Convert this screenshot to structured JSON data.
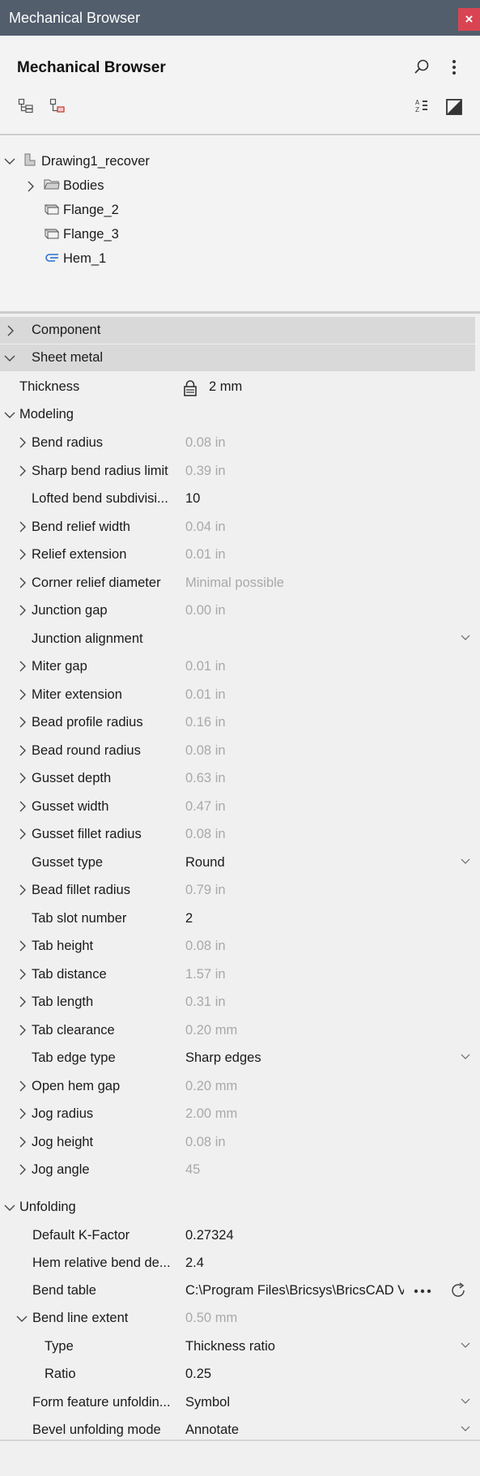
{
  "window": {
    "title": "Mechanical Browser",
    "close_glyph": "×"
  },
  "panel": {
    "title": "Mechanical Browser"
  },
  "tree": {
    "root": "Drawing1_recover",
    "items": [
      "Bodies",
      "Flange_2",
      "Flange_3",
      "Hem_1"
    ]
  },
  "sections": {
    "component": "Component",
    "sheet_metal": "Sheet metal"
  },
  "props": {
    "thickness": {
      "name": "Thickness",
      "value": "2 mm"
    },
    "modeling": "Modeling",
    "rows": [
      {
        "name": "Bend radius",
        "value": "0.08 in"
      },
      {
        "name": "Sharp bend radius limit",
        "value": "0.39 in"
      },
      {
        "name": "Lofted bend subdivisi...",
        "value": "10"
      },
      {
        "name": "Bend relief width",
        "value": "0.04 in"
      },
      {
        "name": "Relief extension",
        "value": "0.01 in"
      },
      {
        "name": "Corner relief diameter",
        "value": "Minimal possible"
      },
      {
        "name": "Junction gap",
        "value": "0.00 in"
      },
      {
        "name": "Junction alignment",
        "value": ""
      },
      {
        "name": "Miter gap",
        "value": "0.01 in"
      },
      {
        "name": "Miter extension",
        "value": "0.01 in"
      },
      {
        "name": "Bead profile radius",
        "value": "0.16 in"
      },
      {
        "name": "Bead round radius",
        "value": "0.08 in"
      },
      {
        "name": "Gusset depth",
        "value": "0.63 in"
      },
      {
        "name": "Gusset width",
        "value": "0.47 in"
      },
      {
        "name": "Gusset fillet radius",
        "value": "0.08 in"
      },
      {
        "name": "Gusset type",
        "value": "Round"
      },
      {
        "name": "Bead fillet radius",
        "value": "0.79 in"
      },
      {
        "name": "Tab slot number",
        "value": "2"
      },
      {
        "name": "Tab height",
        "value": "0.08 in"
      },
      {
        "name": "Tab distance",
        "value": "1.57 in"
      },
      {
        "name": "Tab length",
        "value": "0.31 in"
      },
      {
        "name": "Tab clearance",
        "value": "0.20 mm"
      },
      {
        "name": "Tab edge type",
        "value": "Sharp edges"
      },
      {
        "name": "Open hem gap",
        "value": "0.20 mm"
      },
      {
        "name": "Jog radius",
        "value": "2.00 mm"
      },
      {
        "name": "Jog height",
        "value": "0.08 in"
      },
      {
        "name": "Jog angle",
        "value": "45"
      }
    ],
    "unfolding": "Unfolding",
    "unfold_rows": [
      {
        "name": "Default K-Factor",
        "value": "0.27324"
      },
      {
        "name": "Hem relative bend de...",
        "value": "2.4"
      },
      {
        "name": "Bend table",
        "value": "C:\\Program Files\\Bricsys\\BricsCAD V"
      },
      {
        "name": "Bend line extent",
        "value": "0.50 mm"
      },
      {
        "name": "Type",
        "value": "Thickness ratio"
      },
      {
        "name": "Ratio",
        "value": "0.25"
      },
      {
        "name": "Form feature unfoldin...",
        "value": "Symbol"
      },
      {
        "name": "Bevel unfolding mode",
        "value": "Annotate"
      }
    ]
  }
}
